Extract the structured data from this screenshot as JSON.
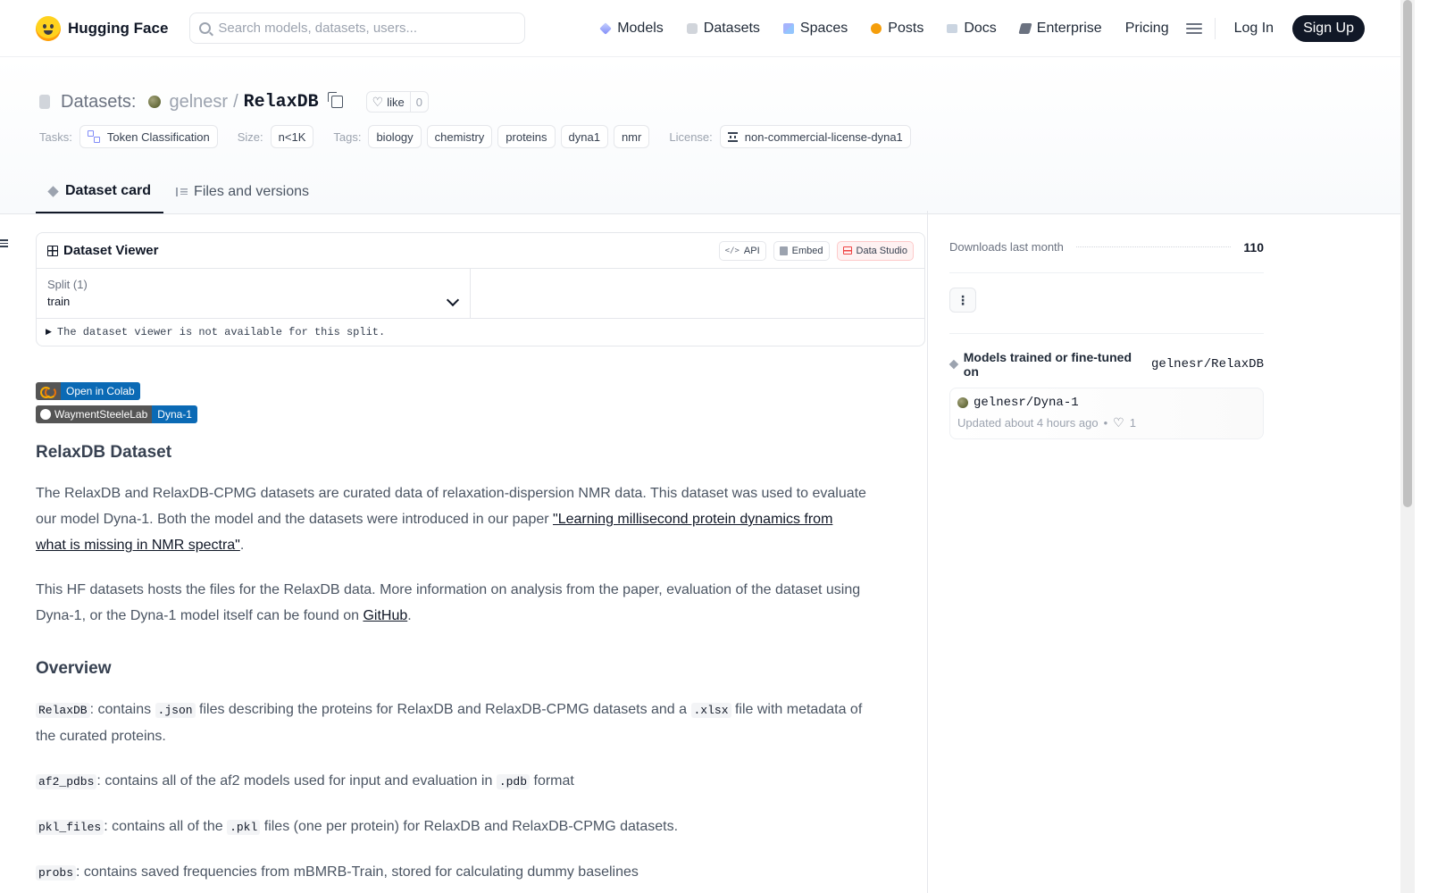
{
  "header": {
    "brand": "Hugging Face",
    "search_placeholder": "Search models, datasets, users...",
    "nav": [
      {
        "label": "Models",
        "icon": "models-icon"
      },
      {
        "label": "Datasets",
        "icon": "datasets-icon"
      },
      {
        "label": "Spaces",
        "icon": "spaces-icon"
      },
      {
        "label": "Posts",
        "icon": "posts-icon"
      },
      {
        "label": "Docs",
        "icon": "docs-icon"
      },
      {
        "label": "Enterprise",
        "icon": "enterprise-icon"
      },
      {
        "label": "Pricing"
      }
    ],
    "login": "Log In",
    "signup": "Sign Up"
  },
  "dataset": {
    "section": "Datasets:",
    "owner": "gelnesr",
    "separator": "/",
    "name": "RelaxDB",
    "like_label": "like",
    "like_count": "0",
    "tasks_label": "Tasks:",
    "task": "Token Classification",
    "size_label": "Size:",
    "size": "n<1K",
    "tags_label": "Tags:",
    "tags": [
      "biology",
      "chemistry",
      "proteins",
      "dyna1",
      "nmr"
    ],
    "license_label": "License:",
    "license": "non-commercial-license-dyna1"
  },
  "tabs": [
    "Dataset card",
    "Files and versions"
  ],
  "viewer": {
    "title": "Dataset Viewer",
    "api": "API",
    "embed": "Embed",
    "studio": "Data Studio",
    "split_label": "Split (1)",
    "split_value": "train",
    "note": "The dataset viewer is not available for this split."
  },
  "badges": {
    "colab": "Open in Colab",
    "github_left": "WaymentSteeleLab",
    "github_right": "Dyna-1"
  },
  "card": {
    "h1": "RelaxDB Dataset",
    "p1_pre": "The RelaxDB and RelaxDB-CPMG datasets are curated data of relaxation-dispersion NMR data. This dataset was used to evaluate our model Dyna-1. Both the model and the datasets were introduced in our paper ",
    "p1_link": "\"Learning millisecond protein dynamics from what is missing in NMR spectra\"",
    "p1_post": ".",
    "p2_pre": "This HF datasets hosts the files for the RelaxDB data. More information on analysis from the paper, evaluation of the dataset using Dyna-1, or the Dyna-1 model itself can be found on ",
    "p2_link": "GitHub",
    "p2_post": ".",
    "h2": "Overview",
    "items": [
      {
        "code": "RelaxDB",
        "t1": ": contains ",
        "c2": ".json",
        "t2": " files describing the proteins for RelaxDB and RelaxDB-CPMG datasets and a ",
        "c3": ".xlsx",
        "t3": " file with metadata of the curated proteins."
      },
      {
        "code": "af2_pdbs",
        "t1": ": contains all of the af2 models used for input and evaluation in ",
        "c2": ".pdb",
        "t2": " format",
        "c3": "",
        "t3": ""
      },
      {
        "code": "pkl_files",
        "t1": ": contains all of the ",
        "c2": ".pkl",
        "t2": " files (one per protein) for RelaxDB and RelaxDB-CPMG datasets.",
        "c3": "",
        "t3": ""
      },
      {
        "code": "probs",
        "t1": ": contains saved frequencies from mBMRB-Train, stored for calculating dummy baselines",
        "c2": "",
        "t2": "",
        "c3": "",
        "t3": ""
      }
    ]
  },
  "sidebar": {
    "downloads_label": "Downloads last month",
    "downloads_value": "110",
    "models_heading": "Models trained or fine-tuned on",
    "models_repo": "gelnesr/RelaxDB",
    "model_name": "gelnesr/Dyna-1",
    "model_updated": "Updated about 4 hours ago",
    "model_dot": "•",
    "model_likes": "1"
  }
}
